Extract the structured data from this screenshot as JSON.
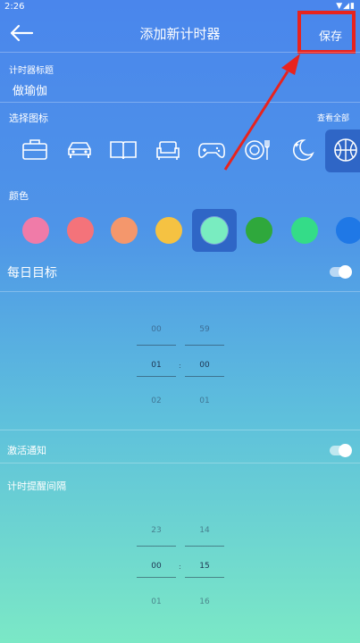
{
  "status": {
    "time": "2:26",
    "icons": "▼◢▮"
  },
  "header": {
    "title": "添加新计时器",
    "save_label": "保存"
  },
  "timer_title": {
    "label": "计时器标题",
    "value": "做瑜伽"
  },
  "icons": {
    "label": "选择图标",
    "view_all": "查看全部",
    "items": [
      "briefcase-icon",
      "car-icon",
      "book-icon",
      "sofa-icon",
      "gamepad-icon",
      "dining-icon",
      "night-icon",
      "basketball-icon"
    ],
    "selected": "basketball-icon"
  },
  "colors": {
    "label": "颜色",
    "items": [
      "#f07ba8",
      "#f4737a",
      "#f4976c",
      "#f5c242",
      "#79ecc0",
      "#2fa83c",
      "#34dc88",
      "#1f78e6"
    ],
    "selected": "#79ecc0"
  },
  "daily_goal": {
    "label": "每日目标",
    "enabled": true,
    "picker": {
      "hours": [
        "00",
        "01",
        "02"
      ],
      "minutes": [
        "59",
        "00",
        "01"
      ],
      "colon": ":"
    }
  },
  "notify": {
    "label": "激活通知",
    "enabled": true
  },
  "interval": {
    "label": "计时提醒间隔",
    "picker": {
      "hours": [
        "23",
        "00",
        "01"
      ],
      "minutes": [
        "14",
        "15",
        "16"
      ],
      "colon": ":"
    }
  },
  "accent": {
    "highlight_red": "#e8231e",
    "selection_blue": "#2f66c6"
  }
}
